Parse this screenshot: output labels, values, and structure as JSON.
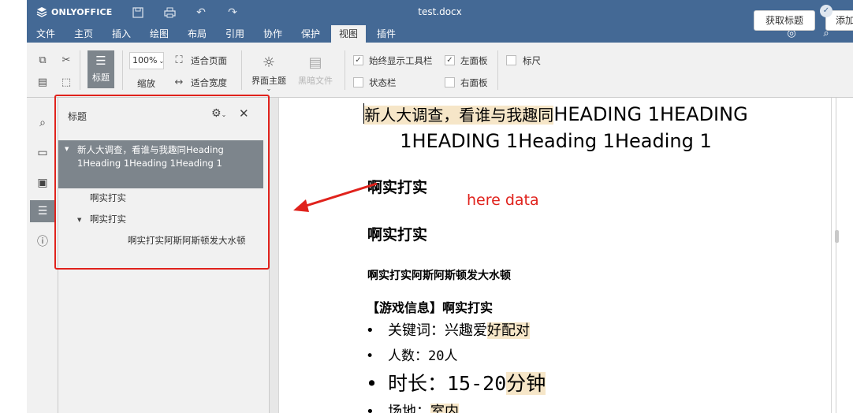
{
  "app": {
    "brand": "ONLYOFFICE",
    "document_title": "test.docx"
  },
  "header_buttons": {
    "get_title": "获取标题",
    "add": "添加"
  },
  "menu": {
    "tabs": [
      "文件",
      "主页",
      "插入",
      "绘图",
      "布局",
      "引用",
      "协作",
      "保护",
      "视图",
      "插件"
    ],
    "active": "视图"
  },
  "toolbar": {
    "headings_label": "标题",
    "zoom_value": "100%",
    "zoom_label": "缩放",
    "fit_page": "适合页面",
    "fit_width": "适合宽度",
    "theme_label": "界面主题",
    "dark_doc_label": "黑暗文件",
    "always_show_toolbar": "始终显示工具栏",
    "status_bar": "状态栏",
    "left_panel": "左面板",
    "right_panel": "右面板",
    "ruler": "标尺"
  },
  "headings_panel": {
    "title": "标题",
    "items": [
      {
        "text": "新人大调查，看谁与我趣同Heading 1Heading 1Heading 1Heading 1",
        "selected": true
      },
      {
        "text": "啊实打实"
      },
      {
        "text": "啊实打实"
      },
      {
        "text": "啊实打实阿斯阿斯顿发大水顿"
      }
    ]
  },
  "annotation": {
    "text": "here data",
    "color": "#e0221c"
  },
  "document": {
    "title_highlight": "新人大调查，看谁与我趣同",
    "title_rest": "HEADING 1HEADING",
    "title_line2": "1HEADING 1Heading 1Heading 1",
    "h2_a": "啊实打实",
    "h2_b": "啊实打实",
    "h3": "啊实打实阿斯阿斯顿发大水顿",
    "info_title": "【游戏信息】啊实打实",
    "bullets": [
      {
        "label": "关键词：兴趣爱",
        "highlight": "好配对"
      },
      {
        "label": "人数：20人",
        "highlight": ""
      },
      {
        "label": "时长：15-20",
        "highlight": "分钟"
      },
      {
        "label": "场地：",
        "highlight": "室内"
      }
    ],
    "bullet_symbol": "•"
  },
  "colors": {
    "brand": "#446995",
    "selected": "#7d858c",
    "highlight": "#f6e6c8",
    "annotation": "#e0221c"
  }
}
